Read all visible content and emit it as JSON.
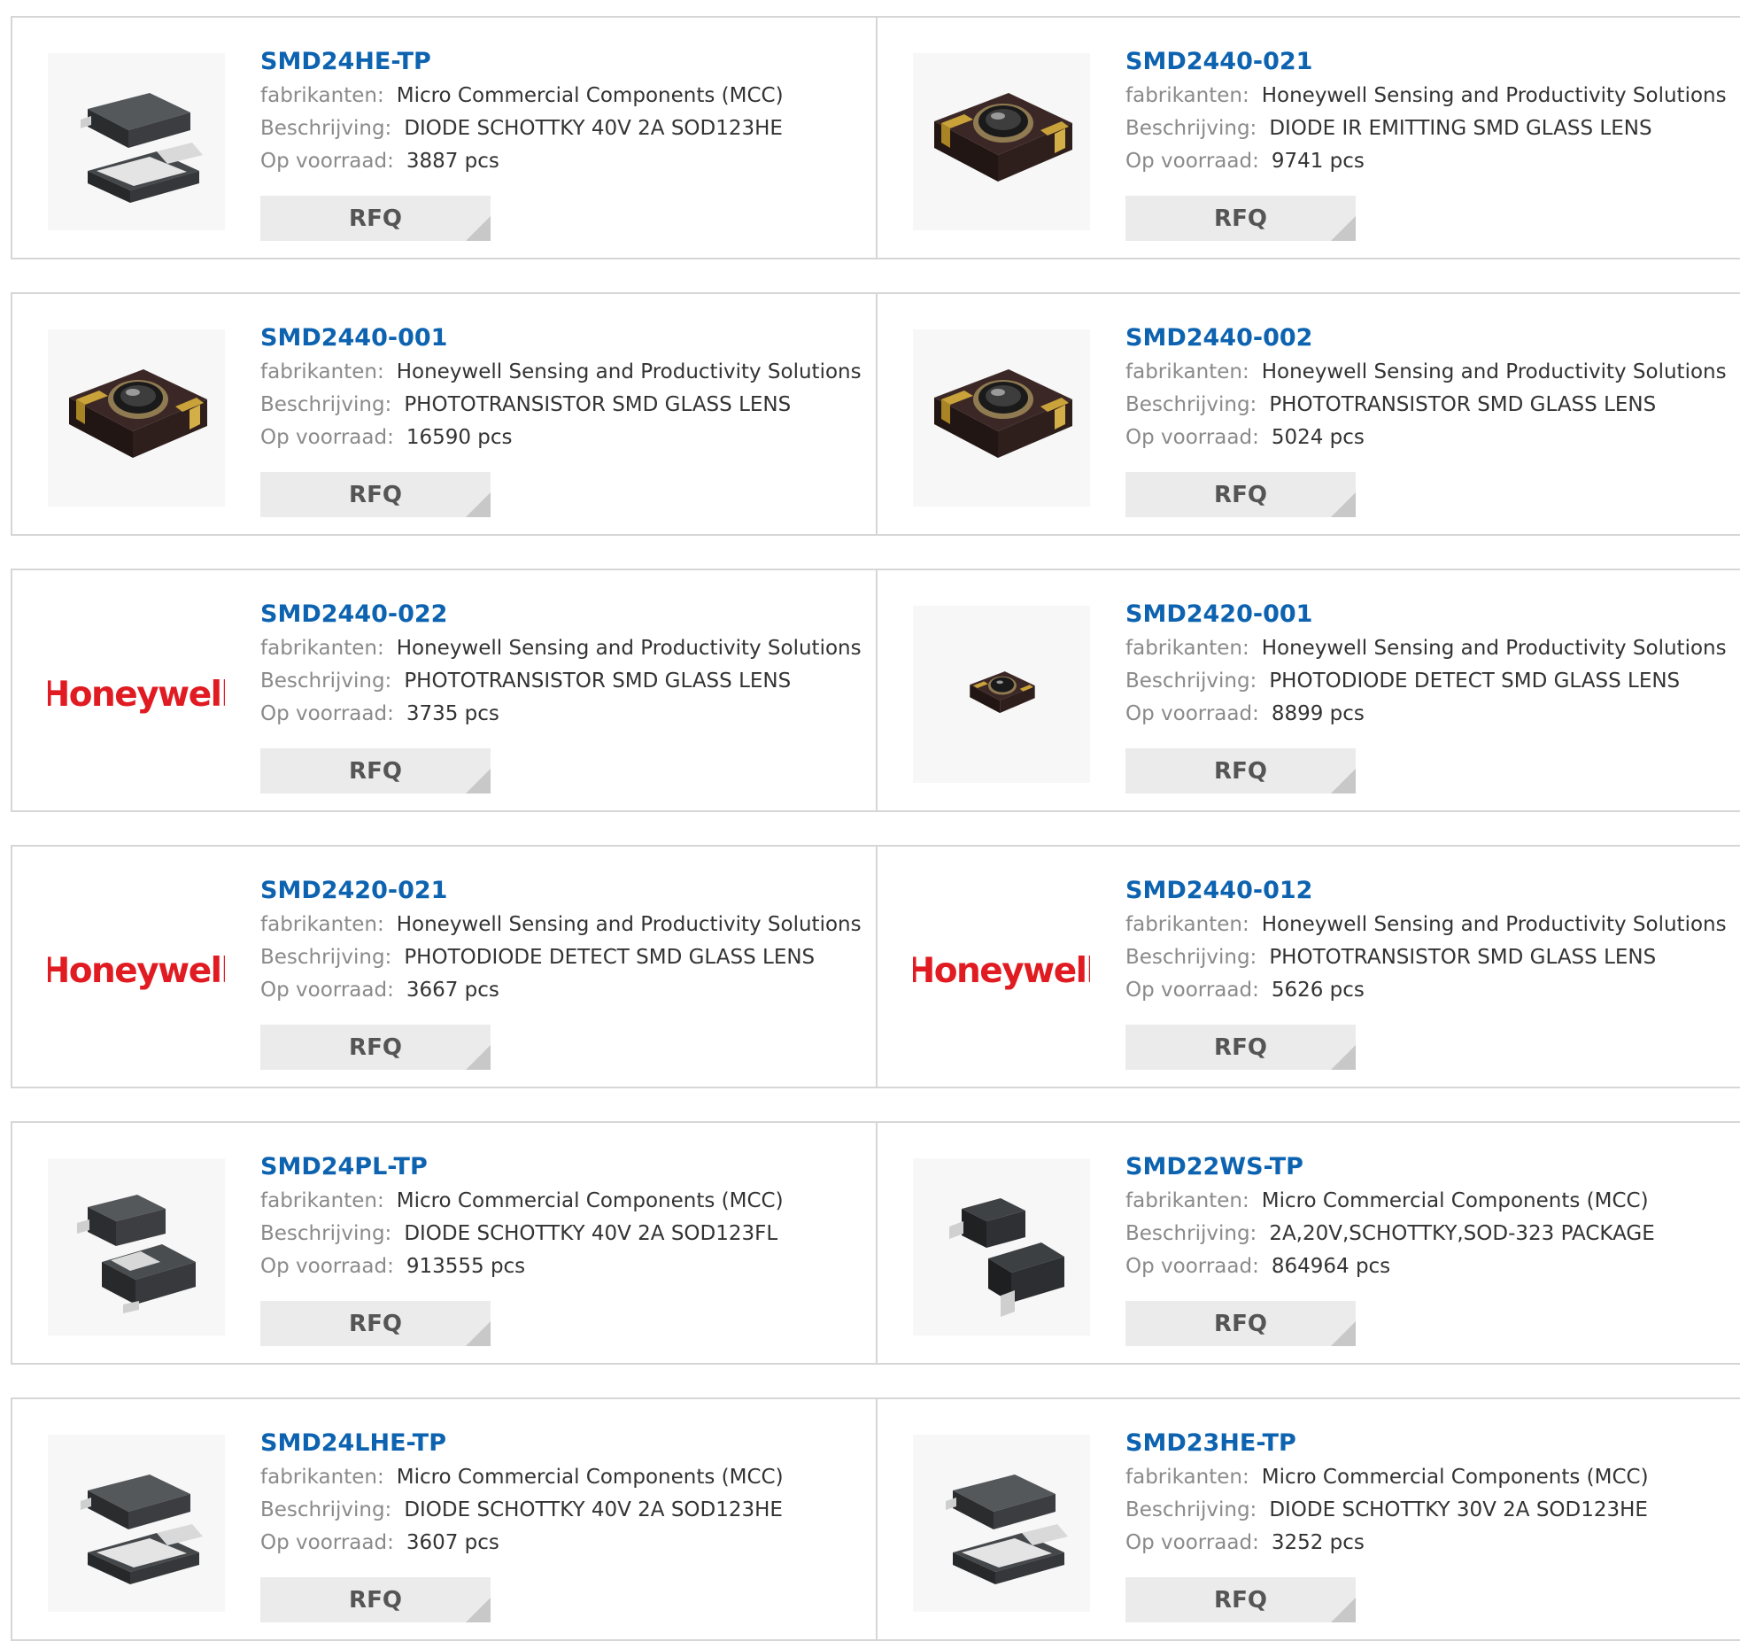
{
  "labels": {
    "manufacturer": "fabrikanten:",
    "description": "Beschrijving:",
    "stock": "Op voorraad:"
  },
  "products": [
    {
      "part": "SMD24HE-TP",
      "manufacturer": "Micro Commercial Components (MCC)",
      "description": "DIODE SCHOTTKY 40V 2A SOD123HE",
      "stock": "3887 pcs",
      "image": "sod123he-diode-image",
      "rfq": "RFQ"
    },
    {
      "part": "SMD2440-021",
      "manufacturer": "Honeywell Sensing and Productivity Solutions",
      "description": "DIODE IR EMITTING SMD GLASS LENS",
      "stock": "9741 pcs",
      "image": "smd-glass-lens-image",
      "rfq": "RFQ"
    },
    {
      "part": "SMD2440-001",
      "manufacturer": "Honeywell Sensing and Productivity Solutions",
      "description": "PHOTOTRANSISTOR SMD GLASS LENS",
      "stock": "16590 pcs",
      "image": "smd-glass-lens-image",
      "rfq": "RFQ"
    },
    {
      "part": "SMD2440-002",
      "manufacturer": "Honeywell Sensing and Productivity Solutions",
      "description": "PHOTOTRANSISTOR SMD GLASS LENS",
      "stock": "5024 pcs",
      "image": "smd-glass-lens-image",
      "rfq": "RFQ"
    },
    {
      "part": "SMD2440-022",
      "manufacturer": "Honeywell Sensing and Productivity Solutions",
      "description": "PHOTOTRANSISTOR SMD GLASS LENS",
      "stock": "3735 pcs",
      "image": "honeywell-logo",
      "logo_text": "Honeywell",
      "rfq": "RFQ"
    },
    {
      "part": "SMD2420-001",
      "manufacturer": "Honeywell Sensing and Productivity Solutions",
      "description": "PHOTODIODE DETECT SMD GLASS LENS",
      "stock": "8899 pcs",
      "image": "smd-glass-lens-small-image",
      "rfq": "RFQ"
    },
    {
      "part": "SMD2420-021",
      "manufacturer": "Honeywell Sensing and Productivity Solutions",
      "description": "PHOTODIODE DETECT SMD GLASS LENS",
      "stock": "3667 pcs",
      "image": "honeywell-logo",
      "logo_text": "Honeywell",
      "rfq": "RFQ"
    },
    {
      "part": "SMD2440-012",
      "manufacturer": "Honeywell Sensing and Productivity Solutions",
      "description": "PHOTOTRANSISTOR SMD GLASS LENS",
      "stock": "5626 pcs",
      "image": "honeywell-logo",
      "logo_text": "Honeywell",
      "rfq": "RFQ"
    },
    {
      "part": "SMD24PL-TP",
      "manufacturer": "Micro Commercial Components (MCC)",
      "description": "DIODE SCHOTTKY 40V 2A SOD123FL",
      "stock": "913555 pcs",
      "image": "sod123fl-diode-image",
      "rfq": "RFQ"
    },
    {
      "part": "SMD22WS-TP",
      "manufacturer": "Micro Commercial Components (MCC)",
      "description": "2A,20V,SCHOTTKY,SOD-323 PACKAGE",
      "stock": "864964 pcs",
      "image": "sod323-diode-image",
      "rfq": "RFQ"
    },
    {
      "part": "SMD24LHE-TP",
      "manufacturer": "Micro Commercial Components (MCC)",
      "description": "DIODE SCHOTTKY 40V 2A SOD123HE",
      "stock": "3607 pcs",
      "image": "sod123he-diode-image",
      "rfq": "RFQ"
    },
    {
      "part": "SMD23HE-TP",
      "manufacturer": "Micro Commercial Components (MCC)",
      "description": "DIODE SCHOTTKY 30V 2A SOD123HE",
      "stock": "3252 pcs",
      "image": "sod123he-diode-image",
      "rfq": "RFQ"
    }
  ],
  "colors": {
    "title": "#0d63b0",
    "label": "#8a8a8a",
    "value": "#333333",
    "button_bg": "#ebebeb",
    "border": "#d6d6d6",
    "logo": "#e01b22"
  }
}
